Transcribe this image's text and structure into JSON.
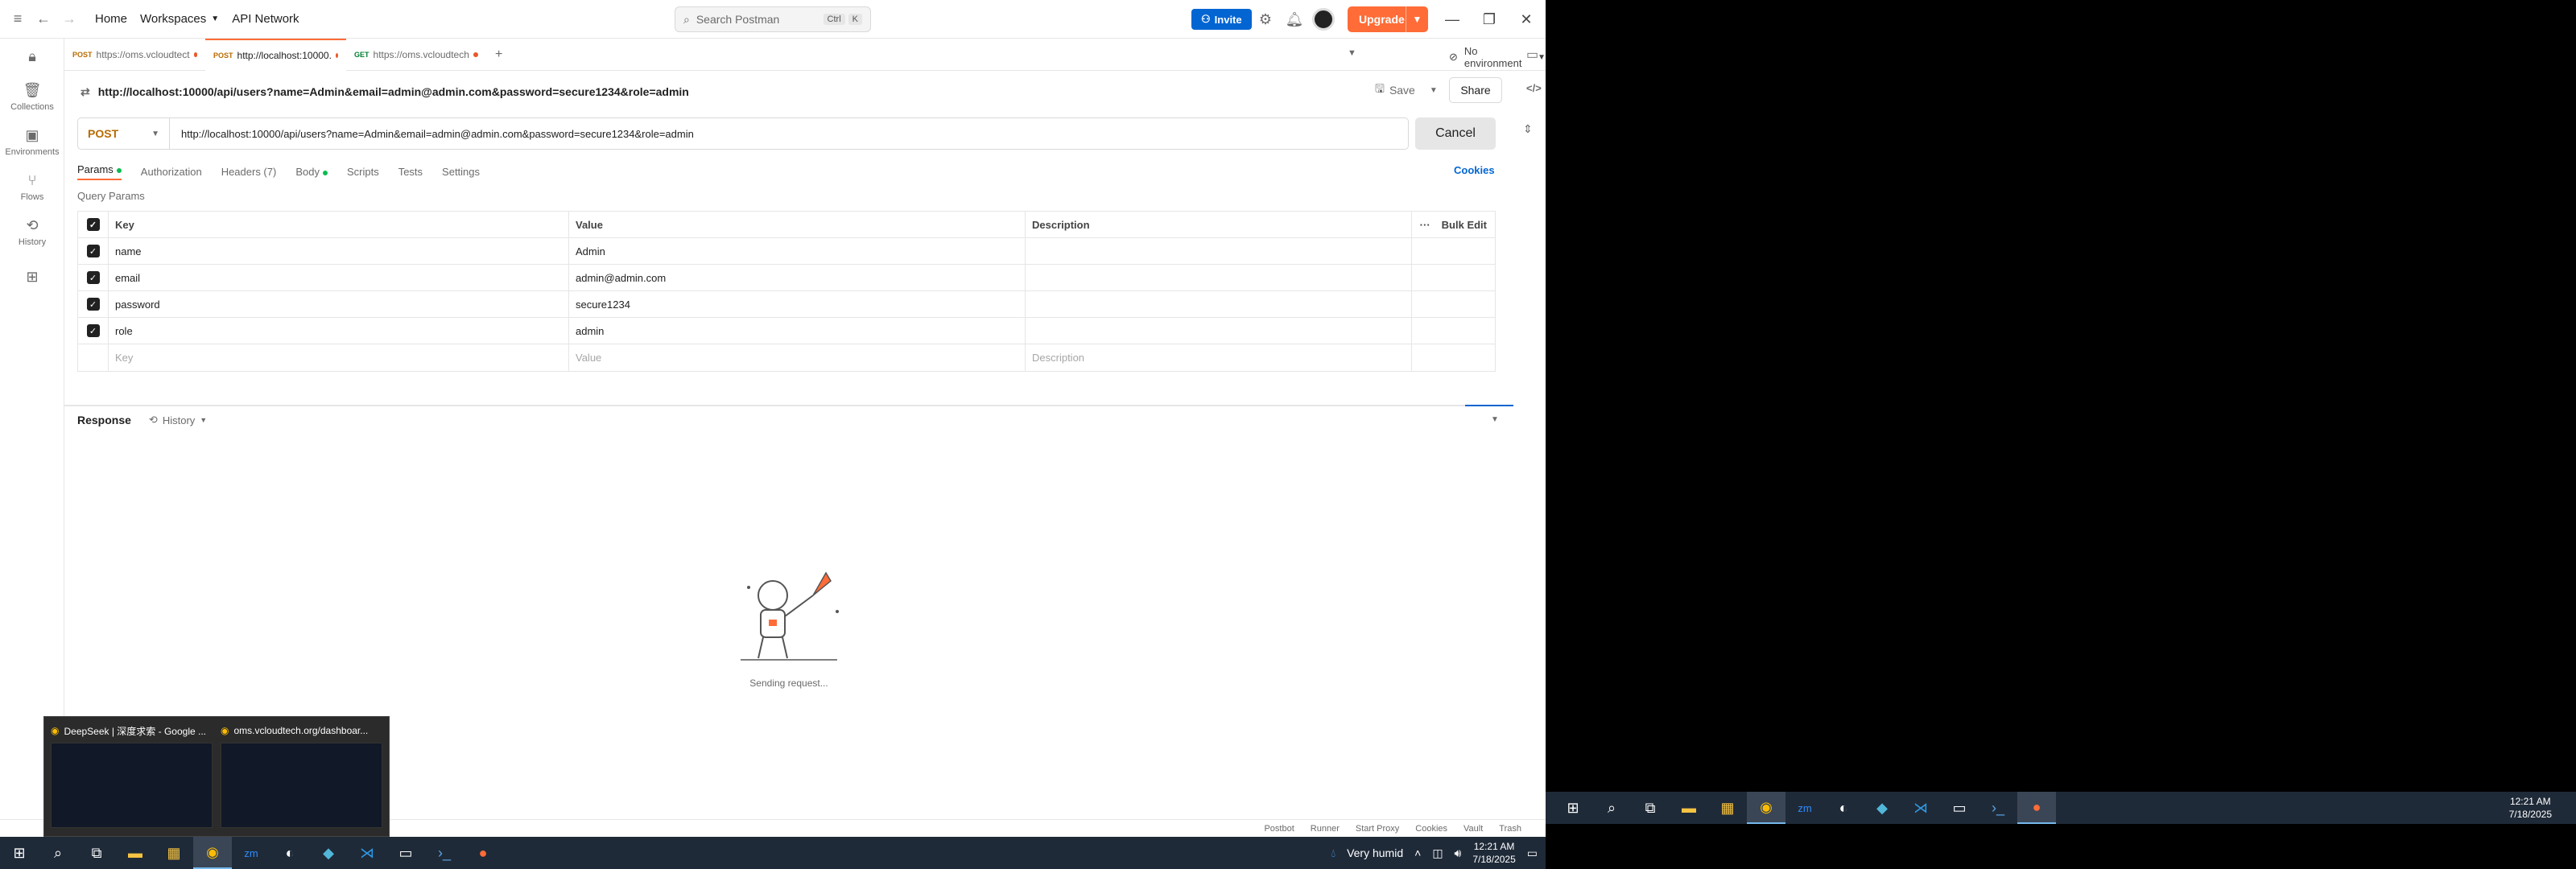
{
  "titlebar": {
    "home": "Home",
    "workspaces": "Workspaces",
    "api_network": "API Network",
    "search_placeholder": "Search Postman",
    "shortcut_ctrl": "Ctrl",
    "shortcut_k": "K",
    "invite": "Invite",
    "upgrade": "Upgrade"
  },
  "sidebar": {
    "items": [
      {
        "label": "Collections",
        "icon": "collections-icon"
      },
      {
        "label": "Environments",
        "icon": "environments-icon"
      },
      {
        "label": "Flows",
        "icon": "flows-icon"
      },
      {
        "label": "History",
        "icon": "history-icon"
      }
    ]
  },
  "tabs": [
    {
      "method": "POST",
      "label": "https://oms.vcloudtect"
    },
    {
      "method": "POST",
      "label": "http://localhost:10000."
    },
    {
      "method": "GET",
      "label": "https://oms.vcloudtech"
    }
  ],
  "environment": "No environment",
  "request": {
    "title": "http://localhost:10000/api/users?name=Admin&email=admin@admin.com&password=secure1234&role=admin",
    "save": "Save",
    "share": "Share",
    "method": "POST",
    "url": "http://localhost:10000/api/users?name=Admin&email=admin@admin.com&password=secure1234&role=admin",
    "cancel": "Cancel"
  },
  "subtabs": {
    "params": "Params",
    "authorization": "Authorization",
    "headers": "Headers (7)",
    "body": "Body",
    "scripts": "Scripts",
    "tests": "Tests",
    "settings": "Settings",
    "cookies": "Cookies"
  },
  "query_params_label": "Query Params",
  "params_table": {
    "headers": {
      "key": "Key",
      "value": "Value",
      "description": "Description",
      "bulk_edit": "Bulk Edit"
    },
    "rows": [
      {
        "key": "name",
        "value": "Admin"
      },
      {
        "key": "email",
        "value": "admin@admin.com"
      },
      {
        "key": "password",
        "value": "secure1234"
      },
      {
        "key": "role",
        "value": "admin"
      }
    ],
    "placeholder": {
      "key": "Key",
      "value": "Value",
      "description": "Description"
    }
  },
  "response": {
    "title": "Response",
    "history": "History",
    "status": "Sending request..."
  },
  "statusbar": [
    "Postbot",
    "Runner",
    "Start Proxy",
    "Cookies",
    "Vault",
    "Trash"
  ],
  "taskbar": {
    "weather": "Very humid",
    "time": "12:21 AM",
    "date": "7/18/2025"
  },
  "thumbnails": [
    {
      "title": "DeepSeek | 深度求索 - Google ..."
    },
    {
      "title": "oms.vcloudtech.org/dashboar..."
    }
  ],
  "colors": {
    "accent": "#ff6c37",
    "invite": "#0265d2",
    "post": "#b86b00",
    "get": "#007f31"
  }
}
